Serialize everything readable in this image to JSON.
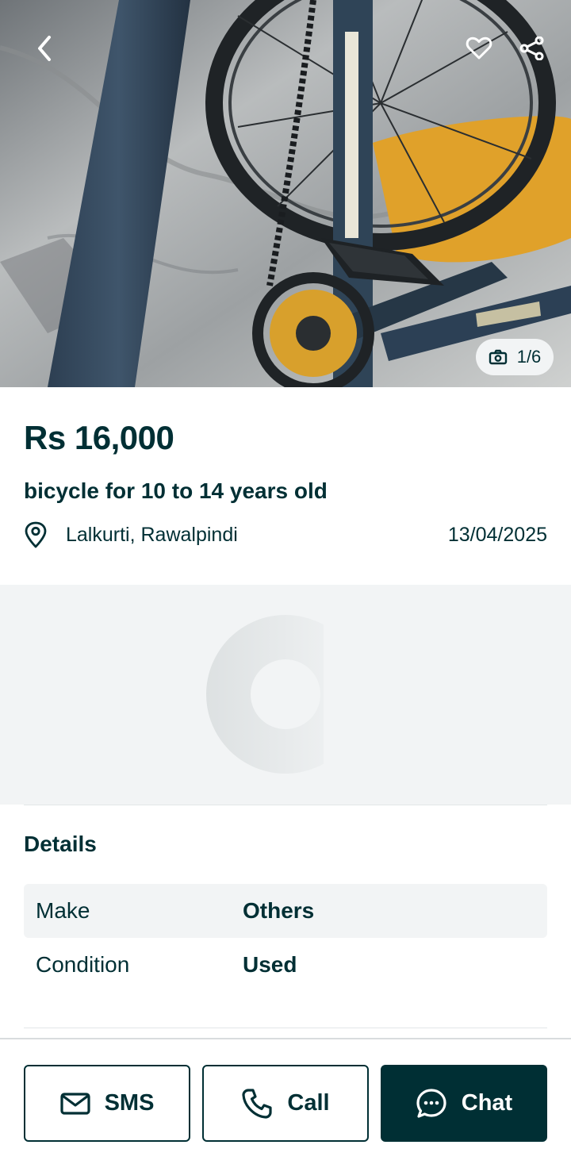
{
  "gallery": {
    "counter": "1/6",
    "back_icon": "chevron-left-icon",
    "favorite_icon": "heart-icon",
    "share_icon": "share-icon",
    "counter_icon": "camera-icon"
  },
  "listing": {
    "price": "Rs 16,000",
    "title": "bicycle for 10 to 14 years old",
    "location": "Lalkurti, Rawalpindi",
    "date": "13/04/2025"
  },
  "details": {
    "heading": "Details",
    "rows": [
      {
        "key": "Make",
        "value": "Others"
      },
      {
        "key": "Condition",
        "value": "Used"
      }
    ]
  },
  "actions": {
    "sms": "SMS",
    "call": "Call",
    "chat": "Chat"
  },
  "colors": {
    "brand_dark": "#002f34",
    "surface_grey": "#f2f4f5"
  }
}
